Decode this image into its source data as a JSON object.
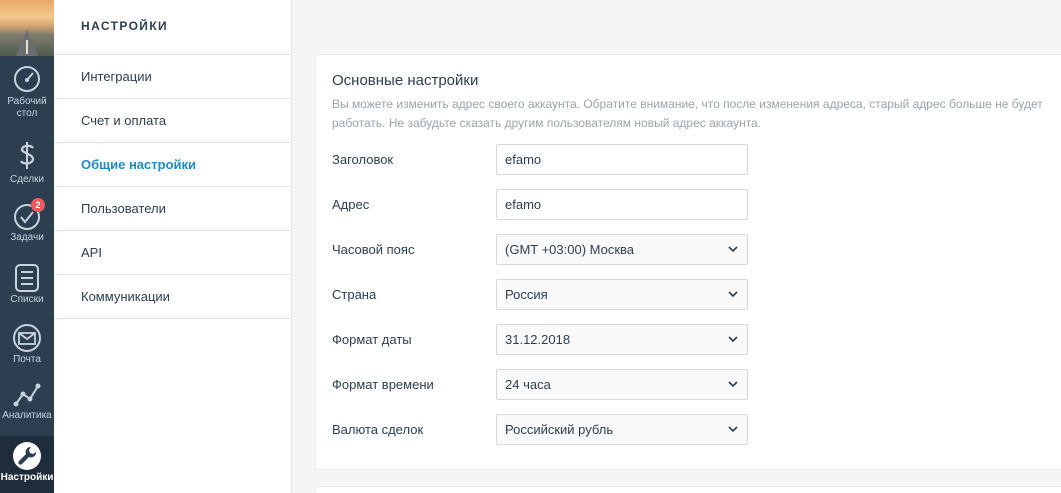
{
  "sidebar": {
    "items": [
      {
        "label": "Рабочий стол",
        "icon": "dashboard-icon"
      },
      {
        "label": "Сделки",
        "icon": "dollar-icon"
      },
      {
        "label": "Задачи",
        "icon": "check-circle-icon",
        "badge": "2"
      },
      {
        "label": "Списки",
        "icon": "list-icon"
      },
      {
        "label": "Почта",
        "icon": "mail-icon"
      },
      {
        "label": "Аналитика",
        "icon": "analytics-icon"
      },
      {
        "label": "Настройки",
        "icon": "wrench-icon",
        "active": true
      }
    ]
  },
  "menu": {
    "title": "НАСТРОЙКИ",
    "items": [
      {
        "label": "Интеграции"
      },
      {
        "label": "Счет и оплата"
      },
      {
        "label": "Общие настройки",
        "active": true
      },
      {
        "label": "Пользователи"
      },
      {
        "label": "API"
      },
      {
        "label": "Коммуникации"
      }
    ]
  },
  "main": {
    "title": "Основные настройки",
    "description": "Вы можете изменить адрес своего аккаунта. Обратите внимание, что после изменения адреса, старый адрес больше не будет работать. Не забудьте сказать другим пользователям новый адрес аккаунта.",
    "fields": {
      "title": {
        "label": "Заголовок",
        "value": "efamo"
      },
      "address": {
        "label": "Адрес",
        "value": "efamo"
      },
      "timezone": {
        "label": "Часовой пояс",
        "value": "(GMT +03:00) Москва"
      },
      "country": {
        "label": "Страна",
        "value": "Россия"
      },
      "date_format": {
        "label": "Формат даты",
        "value": "31.12.2018"
      },
      "time_format": {
        "label": "Формат времени",
        "value": "24 часа"
      },
      "currency": {
        "label": "Валюта сделок",
        "value": "Российский рубль"
      }
    }
  },
  "colors": {
    "sidebar_bg": "#2c3e50",
    "accent": "#1e8bc3",
    "badge": "#ef5a5a"
  }
}
